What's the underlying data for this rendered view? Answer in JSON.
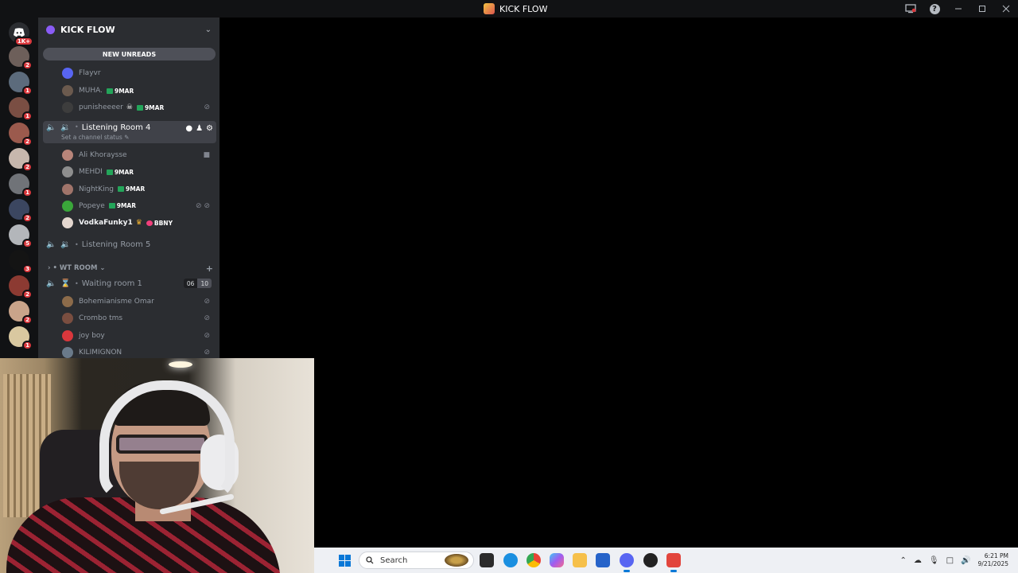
{
  "window": {
    "title": "KICK FLOW",
    "icons": [
      "screen-share-icon",
      "help-icon",
      "minimize-icon",
      "maximize-icon",
      "close-icon"
    ]
  },
  "servers": {
    "home_badge": "1K+",
    "items": [
      {
        "badge": "2",
        "color": "#6d5f5a"
      },
      {
        "badge": "1",
        "color": "#5c6b7c"
      },
      {
        "badge": "1",
        "color": "#7a4e43"
      },
      {
        "badge": "2",
        "color": "#9b5a4d"
      },
      {
        "badge": "2",
        "color": "#c7b7ad"
      },
      {
        "badge": "1",
        "color": "#707378"
      },
      {
        "badge": "2",
        "color": "#3b4660"
      },
      {
        "badge": "5",
        "color": "#b3b6ba"
      },
      {
        "badge": "3",
        "color": "#141414"
      },
      {
        "badge": "2",
        "color": "#8c3a32"
      },
      {
        "badge": "2",
        "color": "#c9a48a"
      },
      {
        "badge": "1",
        "color": "#d9c8a0"
      }
    ]
  },
  "guild": {
    "name": "KICK FLOW",
    "new_unreads": "NEW UNREADS"
  },
  "voice_top": [
    {
      "name": "Flayvr",
      "tag": "",
      "avatar": "#5865f2"
    },
    {
      "name": "MUHA.",
      "tag": "9MAR",
      "avatar": "#6b5a4e"
    },
    {
      "name": "punisheeeer",
      "tag": "9MAR",
      "avatar": "#3d3d3d",
      "skull": true,
      "muted": true
    }
  ],
  "listening4": {
    "name": "Listening Room 4",
    "status": "Set a channel status",
    "members": [
      {
        "name": "Ali Khoraysse",
        "tag": "",
        "avatar": "#b8857a",
        "camera": true
      },
      {
        "name": "MEHDI",
        "tag": "9MAR",
        "avatar": "#8e8e8e"
      },
      {
        "name": "NightKing",
        "tag": "9MAR",
        "avatar": "#a0746a"
      },
      {
        "name": "Popeye",
        "tag": "9MAR",
        "avatar": "#3aa63a",
        "muted": true
      },
      {
        "name": "VodkaFunky1",
        "tag": "BBNY",
        "avatar": "#e4d7cf",
        "crown": true
      }
    ]
  },
  "listening5": {
    "name": "Listening Room 5"
  },
  "category": {
    "name": "WT ROOM"
  },
  "waiting1": {
    "name": "Waiting room 1",
    "count": "06",
    "limit": "10",
    "members": [
      {
        "name": "Bohemianisme Omar",
        "avatar": "#8c6b4a"
      },
      {
        "name": "Crombo tms",
        "avatar": "#7a4e40"
      },
      {
        "name": "joy boy",
        "avatar": "#da373c"
      },
      {
        "name": "KILIMIGNON",
        "avatar": "#6a7a8a"
      }
    ]
  },
  "taskbar": {
    "search_placeholder": "Search",
    "time": "6:21 PM",
    "date": "9/21/2025"
  }
}
